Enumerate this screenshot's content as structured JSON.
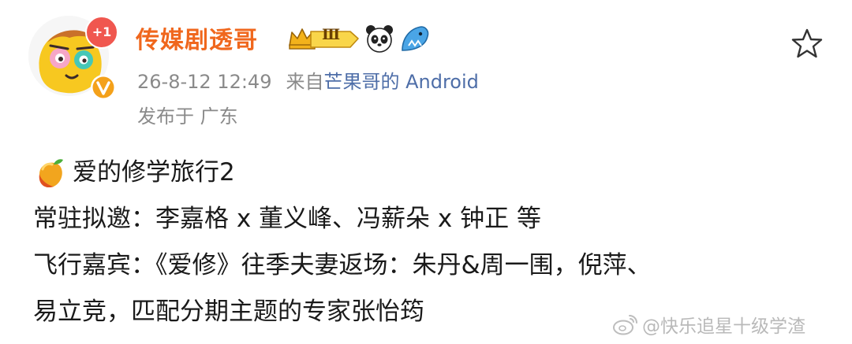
{
  "author": {
    "name": "传媒剧透哥",
    "notification_badge": "+1",
    "vip_level": "Ⅲ",
    "badge_icons": [
      "crown-icon",
      "panda-icon",
      "shark-icon"
    ],
    "name_color": "#f0671d"
  },
  "meta": {
    "time": "26-8-12 12:49",
    "source_prefix": "来自",
    "source_name": "芒果哥的 Android",
    "location": "发布于 广东"
  },
  "post": {
    "lines": [
      "爱的修学旅行2",
      "常驻拟邀：李嘉格 x 董义峰、冯薪朵 x 钟正 等",
      "飞行嘉宾：《爱修》往季夫妻返场：朱丹&周一围，倪萍、",
      "易立竞，匹配分期主题的专家张怡筠"
    ],
    "leading_icon": "mango-icon"
  },
  "watermark": {
    "text": "@快乐追星十级学渣",
    "icon": "weibo-icon"
  },
  "colors": {
    "accent_orange": "#f0671d",
    "link_blue": "#4e6ea8",
    "meta_gray": "#8a8a8a",
    "badge_red": "#f0574f"
  }
}
